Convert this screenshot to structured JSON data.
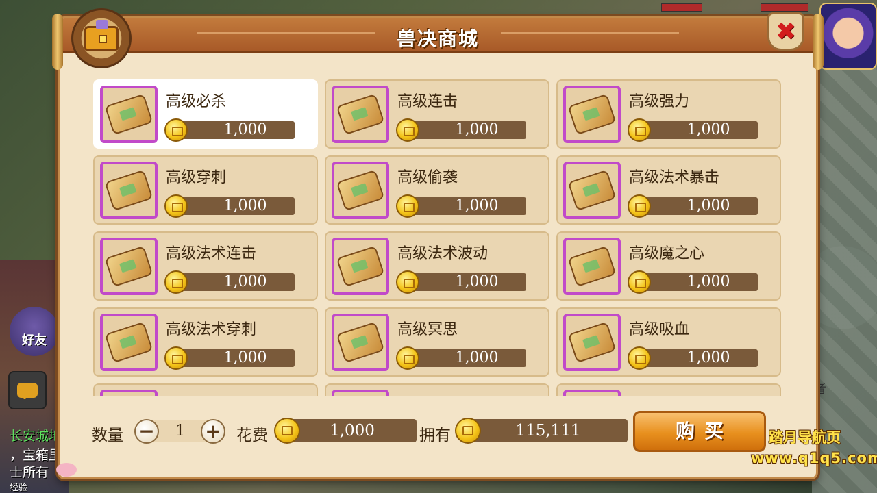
{
  "shop": {
    "title": "兽决商城",
    "close_label": "✖",
    "items": [
      {
        "name": "高级必杀",
        "price": "1,000",
        "selected": true
      },
      {
        "name": "高级连击",
        "price": "1,000"
      },
      {
        "name": "高级强力",
        "price": "1,000"
      },
      {
        "name": "高级穿刺",
        "price": "1,000"
      },
      {
        "name": "高级偷袭",
        "price": "1,000"
      },
      {
        "name": "高级法术暴击",
        "price": "1,000"
      },
      {
        "name": "高级法术连击",
        "price": "1,000"
      },
      {
        "name": "高级法术波动",
        "price": "1,000"
      },
      {
        "name": "高级魔之心",
        "price": "1,000"
      },
      {
        "name": "高级法术穿刺",
        "price": "1,000"
      },
      {
        "name": "高级冥思",
        "price": "1,000"
      },
      {
        "name": "高级吸血",
        "price": "1,000"
      },
      {
        "name": "",
        "price": ""
      },
      {
        "name": "",
        "price": ""
      },
      {
        "name": "",
        "price": ""
      }
    ]
  },
  "footer": {
    "quantity_label": "数量",
    "quantity_value": "1",
    "minus_label": "−",
    "plus_label": "+",
    "cost_label": "花费",
    "cost_value": "1,000",
    "owned_label": "拥有",
    "owned_value": "115,111",
    "buy_label": "购买"
  },
  "background": {
    "friend_label": "好友",
    "side_line_1": "长安城地",
    "side_line_2": "，宝箱里",
    "side_line_3": "士所有",
    "side_line_4": "经验",
    "right_text": "者"
  },
  "watermark": {
    "line1": "踏月导航页",
    "line2": "www.q1q5.com"
  }
}
